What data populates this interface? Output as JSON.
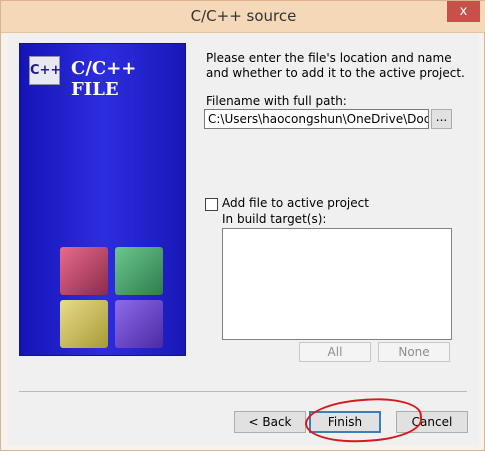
{
  "window": {
    "title": "C/C++ source",
    "close_label": "x"
  },
  "side_panel": {
    "logo_text": "C++",
    "title": "C/C++ FILE"
  },
  "form": {
    "prompt": "Please enter the file's location and name and whether to add it to the active project.",
    "path_label": "Filename with full path:",
    "path_value": "C:\\Users\\haocongshun\\OneDrive\\Docur",
    "browse_label": "...",
    "add_to_project": {
      "label": "Add file to active project",
      "checked": false
    },
    "build_target_label": "In build target(s):",
    "build_targets": [],
    "all_label": "All",
    "none_label": "None"
  },
  "footer": {
    "back_label": "< Back",
    "finish_label": "Finish",
    "cancel_label": "Cancel"
  },
  "colors": {
    "title_bar": "#f5d8b8",
    "side_panel": "#1e1ec8",
    "annotation": "#d8181c"
  },
  "icons": {
    "close": "close-icon",
    "logo": "codeblocks-logo",
    "cubes": "codeblocks-cubes-icon"
  }
}
